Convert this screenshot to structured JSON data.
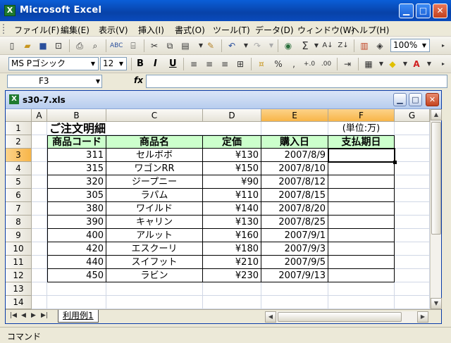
{
  "app": {
    "title": "Microsoft Excel",
    "icon": "X"
  },
  "menu": [
    "ファイル(F)",
    "編集(E)",
    "表示(V)",
    "挿入(I)",
    "書式(O)",
    "ツール(T)",
    "データ(D)",
    "ウィンドウ(W)",
    "ヘルプ(H)"
  ],
  "toolbar": {
    "zoom": "100%",
    "font_name": "MS Pゴシック",
    "font_size": "12",
    "bold": "B",
    "italic": "I",
    "underline": "U",
    "percent": "%",
    "comma": ","
  },
  "formula_bar": {
    "name_box": "F3",
    "fx": "fx",
    "value": ""
  },
  "workbook": {
    "title": "s30-7.xls",
    "icon": "X"
  },
  "columns": [
    "A",
    "B",
    "C",
    "D",
    "E",
    "F",
    "G"
  ],
  "rows": [
    "1",
    "2",
    "3",
    "4",
    "5",
    "6",
    "7",
    "8",
    "9",
    "10",
    "11",
    "12",
    "13",
    "14"
  ],
  "sheet": {
    "title": "ご注文明細",
    "unit": "(単位:万)",
    "headers": [
      "商品コード",
      "商品名",
      "定価",
      "購入日",
      "支払期日"
    ],
    "data": [
      [
        "311",
        "セルボボ",
        "¥130",
        "2007/8/9",
        ""
      ],
      [
        "315",
        "ワゴンRR",
        "¥150",
        "2007/8/10",
        ""
      ],
      [
        "320",
        "ジープニー",
        "¥90",
        "2007/8/12",
        ""
      ],
      [
        "305",
        "ラパム",
        "¥110",
        "2007/8/15",
        ""
      ],
      [
        "380",
        "ワイルド",
        "¥140",
        "2007/8/20",
        ""
      ],
      [
        "390",
        "キャリン",
        "¥130",
        "2007/8/25",
        ""
      ],
      [
        "400",
        "アルット",
        "¥160",
        "2007/9/1",
        ""
      ],
      [
        "420",
        "エスクーリ",
        "¥180",
        "2007/9/3",
        ""
      ],
      [
        "440",
        "スイフット",
        "¥210",
        "2007/9/5",
        ""
      ],
      [
        "450",
        "ラビン",
        "¥230",
        "2007/9/13",
        ""
      ]
    ]
  },
  "sheet_tab": "利用例1",
  "status": "コマンド"
}
